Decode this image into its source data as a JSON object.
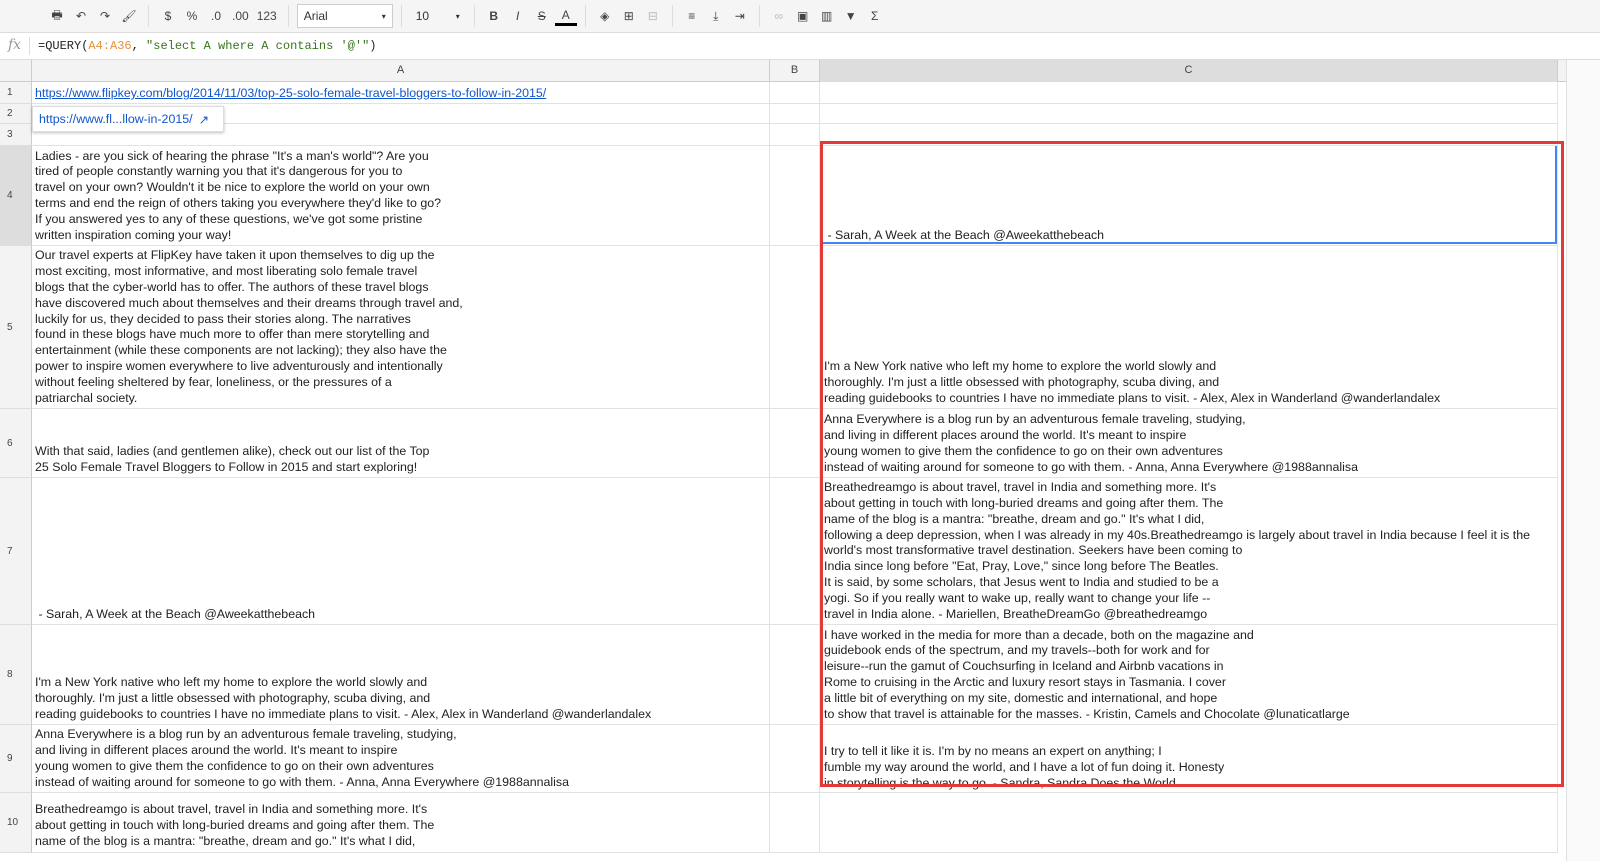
{
  "toolbar": {
    "font": "Arial",
    "font_size": "10",
    "currency": "$",
    "percent": "%",
    "dec_less": ".0",
    "dec_more": ".00",
    "format_more": "123",
    "sum": "Σ"
  },
  "formula_bar": {
    "fx": "fx",
    "prefix": "=QUERY(",
    "range": "A4:A36",
    "comma": ", ",
    "query": "\"select A where A contains '@'\"",
    "suffix": ")"
  },
  "columns": [
    "A",
    "B",
    "C"
  ],
  "link_tooltip": "https://www.fl...llow-in-2015/",
  "rows": [
    {
      "n": "1",
      "a": [
        "https://www.flipkey.com/blog/2014/11/03/top-25-solo-female-travel-bloggers-to-follow-in-2015/"
      ],
      "link": true,
      "c": []
    },
    {
      "n": "2",
      "a": [],
      "c": []
    },
    {
      "n": "3",
      "a": [],
      "c": []
    },
    {
      "n": "4",
      "a": [
        "Ladies - are you sick of hearing the phrase \"It's a man's world\"? Are you",
        "tired of people constantly warning you that it's dangerous for you to",
        "travel on your own? Wouldn't it be nice to explore the world on your own",
        "terms and end the reign of others taking you everywhere they'd like to go?",
        "If you answered yes to any of these questions, we've got some pristine",
        "written inspiration coming your way!"
      ],
      "c": [
        " - Sarah, A Week at the Beach @Aweekatthebeach"
      ]
    },
    {
      "n": "5",
      "a": [
        "Our travel experts at FlipKey have taken it upon themselves to dig up the",
        "most exciting, most informative, and most liberating solo female travel",
        "blogs that the cyber-world has to offer. The authors of these travel blogs",
        "have discovered much about themselves and their dreams through travel and,",
        "luckily for us, they decided to pass their stories along. The narratives",
        "found in these blogs have much more to offer than mere storytelling and",
        "entertainment (while these components are not lacking); they also have the",
        "power to inspire women everywhere to live adventurously and intentionally",
        "without feeling sheltered by fear, loneliness, or the pressures of a",
        "patriarchal society."
      ],
      "c": [
        "I'm a New York native who left my home to explore the world slowly and",
        "thoroughly. I'm just a little obsessed with photography, scuba diving, and",
        "reading guidebooks to countries I have no immediate plans to visit. - Alex, Alex in Wanderland @wanderlandalex"
      ]
    },
    {
      "n": "6",
      "a": [
        "With that said, ladies (and gentlemen alike), check out our list of the Top",
        "25 Solo Female Travel Bloggers to Follow in 2015 and start exploring!"
      ],
      "c": [
        "Anna Everywhere is a blog run by an adventurous female traveling, studying,",
        "and living in different places around the world. It's meant to inspire",
        "young women to give them the confidence to go on their own adventures",
        "instead of waiting around for someone to go with them. - Anna, Anna Everywhere @1988annalisa"
      ]
    },
    {
      "n": "7",
      "a": [
        " - Sarah, A Week at the Beach @Aweekatthebeach"
      ],
      "c": [
        "Breathedreamgo is about travel, travel in India and something more. It's",
        "about getting in touch with long-buried dreams and going after them. The",
        "name of the blog is a mantra: \"breathe, dream and go.\" It's what I did,",
        "following a deep depression, when I was already in my 40s.Breathedreamgo is largely about travel in India because I feel it is the",
        "world's most transformative travel destination. Seekers have been coming to",
        "India since long before \"Eat, Pray, Love,\" since long before The Beatles.",
        "It is said, by some scholars, that Jesus went to India and studied to be a",
        "yogi. So if you really want to wake up, really want to change your life --",
        "travel in India alone. - Mariellen, BreatheDreamGo @breathedreamgo"
      ]
    },
    {
      "n": "8",
      "a": [
        "I'm a New York native who left my home to explore the world slowly and",
        "thoroughly. I'm just a little obsessed with photography, scuba diving, and",
        "reading guidebooks to countries I have no immediate plans to visit. - Alex, Alex in Wanderland @wanderlandalex"
      ],
      "c": [
        "I have worked in the media for more than a decade, both on the magazine and",
        "guidebook ends of the spectrum, and my travels--both for work and for",
        "leisure--run the gamut of Couchsurfing in Iceland and Airbnb vacations in",
        "Rome to cruising in the Arctic and luxury resort stays in Tasmania. I cover",
        "a little bit of everything on my site, domestic and international, and hope",
        "to show that travel is attainable for the masses. - Kristin, Camels and Chocolate @lunaticatlarge"
      ]
    },
    {
      "n": "9",
      "a": [
        "Anna Everywhere is a blog run by an adventurous female traveling, studying,",
        "and living in different places around the world. It's meant to inspire",
        "young women to give them the confidence to go on their own adventures",
        "instead of waiting around for someone to go with them. - Anna, Anna Everywhere @1988annalisa"
      ],
      "c": [
        "I try to tell it like it is. I'm by no means an expert on anything; I",
        "fumble my way around the world, and I have a lot of fun doing it. Honesty",
        "in storytelling is the way to go. - Sandra, Sandra Does the World"
      ]
    },
    {
      "n": "10",
      "a": [
        "Breathedreamgo is about travel, travel in India and something more. It's",
        "about getting in touch with long-buried dreams and going after them. The",
        "name of the blog is a mantra: \"breathe, dream and go.\" It's what I did,"
      ],
      "c": []
    }
  ],
  "highlight_color": "#e53935"
}
